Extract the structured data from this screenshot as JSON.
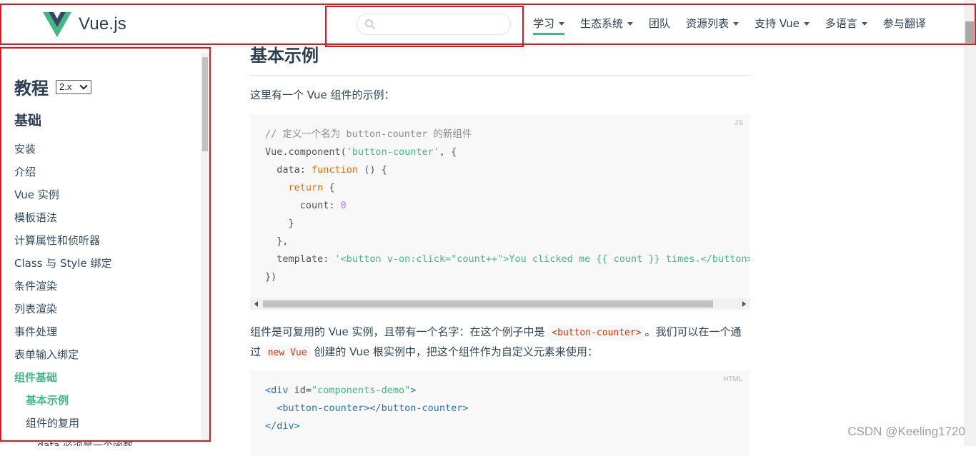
{
  "header": {
    "logo_text": "Vue.js",
    "search_placeholder": "",
    "nav": [
      {
        "label": "学习",
        "dropdown": true,
        "active": true
      },
      {
        "label": "生态系统",
        "dropdown": true
      },
      {
        "label": "团队",
        "dropdown": false
      },
      {
        "label": "资源列表",
        "dropdown": true
      },
      {
        "label": "支持 Vue",
        "dropdown": true
      },
      {
        "label": "多语言",
        "dropdown": true
      },
      {
        "label": "参与翻译",
        "dropdown": false
      }
    ]
  },
  "sidebar": {
    "title": "教程",
    "version": "2.x",
    "section": "基础",
    "items": [
      {
        "label": "安装"
      },
      {
        "label": "介绍"
      },
      {
        "label": "Vue 实例"
      },
      {
        "label": "模板语法"
      },
      {
        "label": "计算属性和侦听器"
      },
      {
        "label": "Class 与 Style 绑定"
      },
      {
        "label": "条件渲染"
      },
      {
        "label": "列表渲染"
      },
      {
        "label": "事件处理"
      },
      {
        "label": "表单输入绑定"
      },
      {
        "label": "组件基础",
        "active": true
      },
      {
        "label": "基本示例",
        "sub": true,
        "active": true
      },
      {
        "label": "组件的复用",
        "sub": true
      },
      {
        "label": "data 必须是一个函数",
        "subsub": true
      }
    ]
  },
  "main": {
    "heading": "基本示例",
    "intro": "这里有一个 Vue 组件的示例：",
    "code1_lang": "JS",
    "code1_lines": [
      "// 定义一个名为 button-counter 的新组件",
      "Vue.component('button-counter', {",
      "  data: function () {",
      "    return {",
      "      count: 0",
      "    }",
      "  },",
      "  template: '<button v-on:click=\"count++\">You clicked me {{ count }} times.</button>'",
      "})"
    ],
    "para2_a": "组件是可复用的 Vue 实例，且带有一个名字：在这个例子中是 ",
    "para2_code1": "<button-counter>",
    "para2_b": "。我们可以在一个通过 ",
    "para2_code2": "new Vue",
    "para2_c": " 创建的 Vue 根实例中，把这个组件作为自定义元素来使用：",
    "code2_lang": "HTML",
    "code2_lines": [
      "<div id=\"components-demo\">",
      "  <button-counter></button-counter>",
      "</div>"
    ]
  },
  "watermark": "CSDN @Keeling1720",
  "colors": {
    "accent": "#42b983",
    "highlight_box": "#e8131b",
    "text": "#2c3e50"
  }
}
